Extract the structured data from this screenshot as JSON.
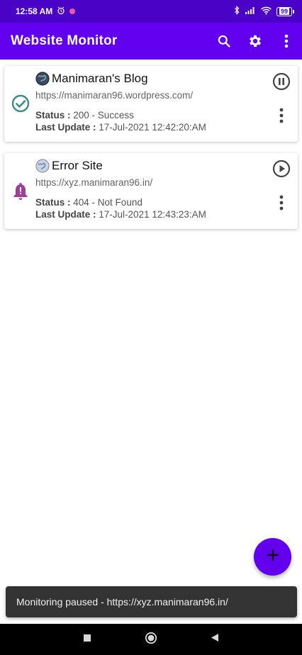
{
  "status_bar": {
    "time": "12:58 AM",
    "battery": "99",
    "icons": [
      "alarm-icon",
      "notification-dot-icon",
      "bluetooth-icon",
      "signal-icon",
      "wifi-icon",
      "battery-icon"
    ]
  },
  "app_bar": {
    "title": "Website Monitor",
    "actions": [
      "search-icon",
      "gear-icon",
      "more-vert-icon"
    ]
  },
  "sites": [
    {
      "name": "Manimaran's Blog",
      "url": "https://manimaran96.wordpress.com/",
      "status_label": "Status :",
      "status": "200 - Success",
      "update_label": "Last Update :",
      "last_update": "17-Jul-2021 12:42:20:AM",
      "state_icon": "check-circle-icon",
      "toggle_icon": "pause-icon",
      "state_color": "#3d8a8a"
    },
    {
      "name": "Error Site",
      "url": "https://xyz.manimaran96.in/",
      "status_label": "Status :",
      "status": "404 - Not Found",
      "update_label": "Last Update :",
      "last_update": "17-Jul-2021 12:43:23:AM",
      "state_icon": "alert-bell-icon",
      "toggle_icon": "play-icon",
      "state_color": "#9c3f9c"
    }
  ],
  "fab": {
    "icon": "plus-icon"
  },
  "snackbar": {
    "message": "Monitoring paused - https://xyz.manimaran96.in/"
  },
  "colors": {
    "primary": "#6200ee",
    "status_bar": "#4a02c7",
    "accent": "#6200ee"
  },
  "nav_bar": {
    "buttons": [
      "recents-icon",
      "home-icon",
      "back-icon"
    ]
  }
}
